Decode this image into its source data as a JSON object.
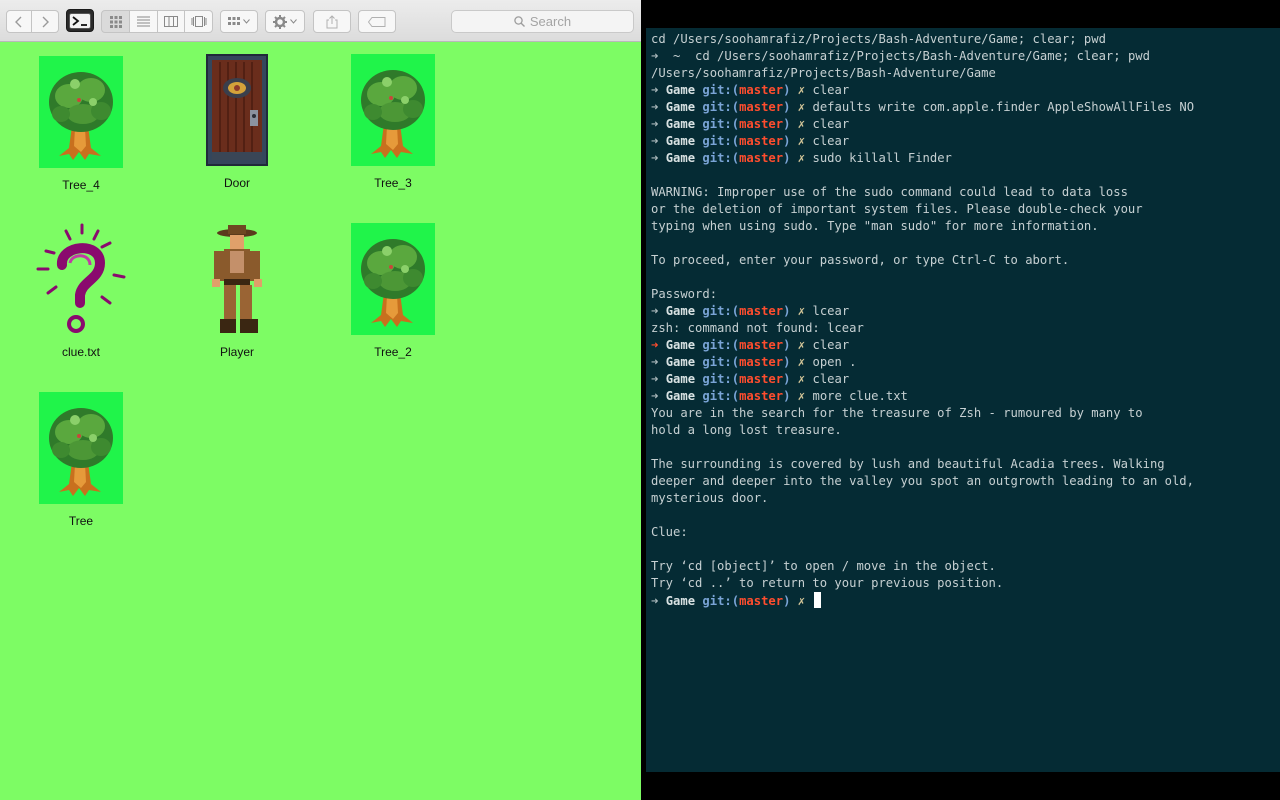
{
  "finder": {
    "search_placeholder": "Search",
    "items": [
      {
        "name": "Tree_4",
        "icon": "tree-icon"
      },
      {
        "name": "Door",
        "icon": "door-icon"
      },
      {
        "name": "Tree_3",
        "icon": "tree-icon"
      },
      {
        "name": "clue.txt",
        "icon": "question-mark-icon"
      },
      {
        "name": "Player",
        "icon": "adventurer-icon"
      },
      {
        "name": "Tree_2",
        "icon": "tree-icon"
      },
      {
        "name": "Tree",
        "icon": "tree-icon"
      }
    ],
    "background_color": "#7dfc64"
  },
  "terminal": {
    "background_color": "#052b34",
    "prompt_dir": "Game",
    "prompt_git": "git:(",
    "prompt_branch": "master",
    "prompt_git_close": ")",
    "prompt_x": "✗",
    "lines": [
      {
        "type": "text",
        "text": "cd /Users/soohamrafiz/Projects/Bash-Adventure/Game; clear; pwd"
      },
      {
        "type": "home",
        "text": "cd /Users/soohamrafiz/Projects/Bash-Adventure/Game; clear; pwd"
      },
      {
        "type": "text",
        "text": "/Users/soohamrafiz/Projects/Bash-Adventure/Game"
      },
      {
        "type": "prompt",
        "text": "clear"
      },
      {
        "type": "prompt",
        "text": "defaults write com.apple.finder AppleShowAllFiles NO"
      },
      {
        "type": "prompt",
        "text": "clear"
      },
      {
        "type": "prompt",
        "text": "clear"
      },
      {
        "type": "prompt",
        "text": "sudo killall Finder"
      },
      {
        "type": "text",
        "text": ""
      },
      {
        "type": "text",
        "text": "WARNING: Improper use of the sudo command could lead to data loss"
      },
      {
        "type": "text",
        "text": "or the deletion of important system files. Please double-check your"
      },
      {
        "type": "text",
        "text": "typing when using sudo. Type \"man sudo\" for more information."
      },
      {
        "type": "text",
        "text": ""
      },
      {
        "type": "text",
        "text": "To proceed, enter your password, or type Ctrl-C to abort."
      },
      {
        "type": "text",
        "text": ""
      },
      {
        "type": "text",
        "text": "Password:"
      },
      {
        "type": "prompt",
        "text": "lcear"
      },
      {
        "type": "text",
        "text": "zsh: command not found: lcear"
      },
      {
        "type": "prompt-err",
        "text": "clear"
      },
      {
        "type": "prompt",
        "text": "open ."
      },
      {
        "type": "prompt",
        "text": "clear"
      },
      {
        "type": "prompt",
        "text": "more clue.txt"
      },
      {
        "type": "text",
        "text": "You are in the search for the treasure of Zsh - rumoured by many to"
      },
      {
        "type": "text",
        "text": "hold a long lost treasure."
      },
      {
        "type": "text",
        "text": ""
      },
      {
        "type": "text",
        "text": "The surrounding is covered by lush and beautiful Acadia trees. Walking"
      },
      {
        "type": "text",
        "text": "deeper and deeper into the valley you spot an outgrowth leading to an old,"
      },
      {
        "type": "text",
        "text": "mysterious door."
      },
      {
        "type": "text",
        "text": ""
      },
      {
        "type": "text",
        "text": "Clue:"
      },
      {
        "type": "text",
        "text": ""
      },
      {
        "type": "text",
        "text": "Try ‘cd [object]’ to open / move in the object."
      },
      {
        "type": "text",
        "text": "Try ‘cd ..’ to return to your previous position."
      },
      {
        "type": "cursor",
        "text": ""
      }
    ]
  }
}
